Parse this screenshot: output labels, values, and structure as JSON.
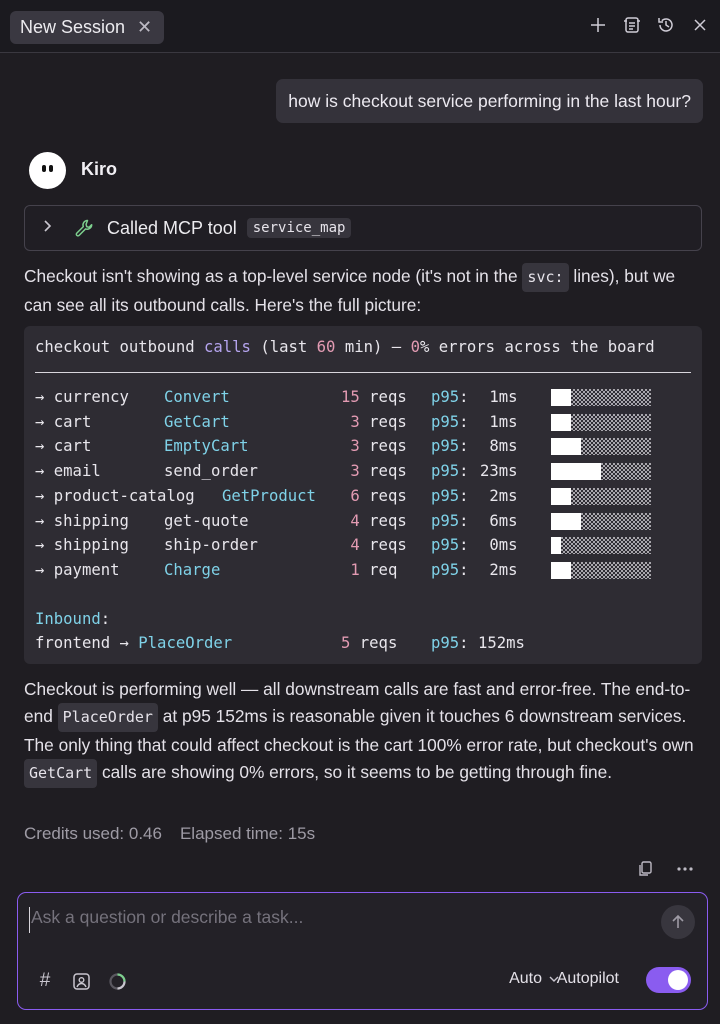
{
  "header": {
    "tab_label": "New Session",
    "icons": [
      "plus-icon",
      "history-list-icon",
      "history-clock-icon",
      "close-icon"
    ]
  },
  "user_message": "how is checkout service performing in the last hour?",
  "assistant": {
    "name": "Kiro",
    "tool_call": {
      "label": "Called MCP tool",
      "tool_name": "service_map"
    },
    "para1": {
      "t1": "Checkout isn't showing as a top-level service node (it's not in the ",
      "code": "svc:",
      "t2": " lines), but we can see all its outbound calls. Here's the full picture:"
    },
    "codeblock": {
      "title": {
        "a": "checkout outbound ",
        "calls": "calls",
        "b": " (last ",
        "num": "60",
        "c": " min) — ",
        "pct": "0",
        "d": "% errors across the board"
      },
      "rows": [
        {
          "arrow": "→",
          "service": "currency",
          "method": "Convert",
          "method_highlight": true,
          "count": "15",
          "unit": "reqs",
          "p95_label": "p95",
          "latency": "1ms",
          "bar_fraction": 0.2
        },
        {
          "arrow": "→",
          "service": "cart",
          "method": "GetCart",
          "method_highlight": true,
          "count": "3",
          "unit": "reqs",
          "p95_label": "p95",
          "latency": "1ms",
          "bar_fraction": 0.2
        },
        {
          "arrow": "→",
          "service": "cart",
          "method": "EmptyCart",
          "method_highlight": true,
          "count": "3",
          "unit": "reqs",
          "p95_label": "p95",
          "latency": "8ms",
          "bar_fraction": 0.3
        },
        {
          "arrow": "→",
          "service": "email",
          "method": "send_order",
          "method_highlight": false,
          "count": "3",
          "unit": "reqs",
          "p95_label": "p95",
          "latency": "23ms",
          "bar_fraction": 0.5
        },
        {
          "arrow": "→",
          "service": "product-catalog",
          "method": "GetProduct",
          "method_highlight": true,
          "count": "6",
          "unit": "reqs",
          "p95_label": "p95",
          "latency": "2ms",
          "bar_fraction": 0.2
        },
        {
          "arrow": "→",
          "service": "shipping",
          "method": "get-quote",
          "method_highlight": false,
          "count": "4",
          "unit": "reqs",
          "p95_label": "p95",
          "latency": "6ms",
          "bar_fraction": 0.3
        },
        {
          "arrow": "→",
          "service": "shipping",
          "method": "ship-order",
          "method_highlight": false,
          "count": "4",
          "unit": "reqs",
          "p95_label": "p95",
          "latency": "0ms",
          "bar_fraction": 0.1
        },
        {
          "arrow": "→",
          "service": "payment",
          "method": "Charge",
          "method_highlight": true,
          "count": "1",
          "unit": "req",
          "p95_label": "p95",
          "latency": "2ms",
          "bar_fraction": 0.2
        }
      ],
      "inbound_label": "Inbound",
      "inbound": {
        "source": "frontend",
        "arrow": "→",
        "method": "PlaceOrder",
        "count": "5",
        "unit": "reqs",
        "p95_label": "p95",
        "latency": "152ms"
      }
    },
    "para2": {
      "t1": "Checkout is performing well — all downstream calls are fast and error-free. The end-to-end ",
      "code1": "PlaceOrder",
      "t2": " at p95 152ms is reasonable given it touches 6 downstream services. The only thing that could affect checkout is the cart 100% error rate, but checkout's own ",
      "code2": "GetCart",
      "t3": " calls are showing 0% errors, so it seems to be getting through fine."
    },
    "credits_used": "Credits used: 0.46",
    "elapsed_time": "Elapsed time: 15s"
  },
  "input": {
    "placeholder": "Ask a question or describe a task...",
    "mode": "Auto",
    "autopilot_label": "Autopilot",
    "autopilot_on": true
  },
  "colors": {
    "accent": "#8a5cf0",
    "code_blue": "#7fd2e8",
    "code_pink": "#e39bb3",
    "code_purple": "#b5a4ee"
  }
}
